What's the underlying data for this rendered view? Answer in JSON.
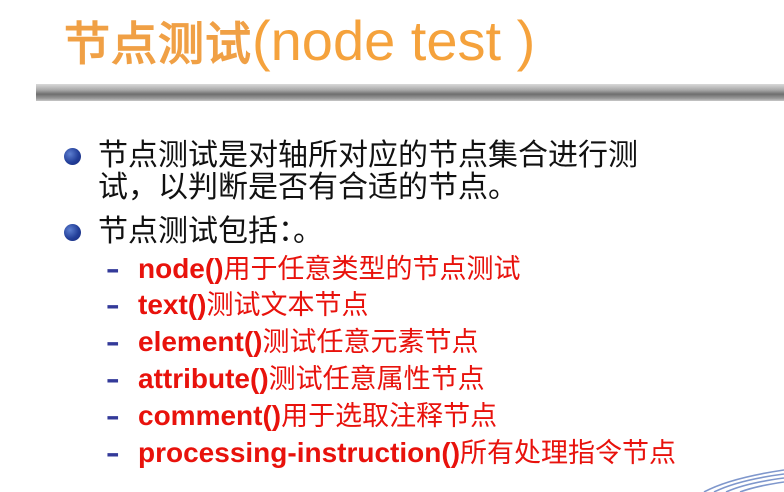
{
  "title": {
    "cn": "节点测试",
    "en": "(node test )"
  },
  "bullets": [
    {
      "line1": "节点测试是对轴所对应的节点集合进行测",
      "line2": "试，以判断是否有合适的节点。"
    },
    {
      "line1": "节点测试包括：。"
    }
  ],
  "sub_items": [
    {
      "dash": "–",
      "keyword": "node()",
      "desc": "用于任意类型的节点测试"
    },
    {
      "dash": "–",
      "keyword": "text()",
      "desc": "测试文本节点"
    },
    {
      "dash": "–",
      "keyword": "element()",
      "desc": "测试任意元素节点"
    },
    {
      "dash": "–",
      "keyword": "attribute()",
      "desc": "测试任意属性节点"
    },
    {
      "dash": "–",
      "keyword": "comment()",
      "desc": "用于选取注释节点"
    },
    {
      "dash": "–",
      "keyword": "processing-instruction()",
      "desc": "所有处理指令节点"
    }
  ],
  "colors": {
    "title": "#f5a23c",
    "keyword": "#e8120c",
    "bullet": "#233f99",
    "dash": "#333a99"
  }
}
